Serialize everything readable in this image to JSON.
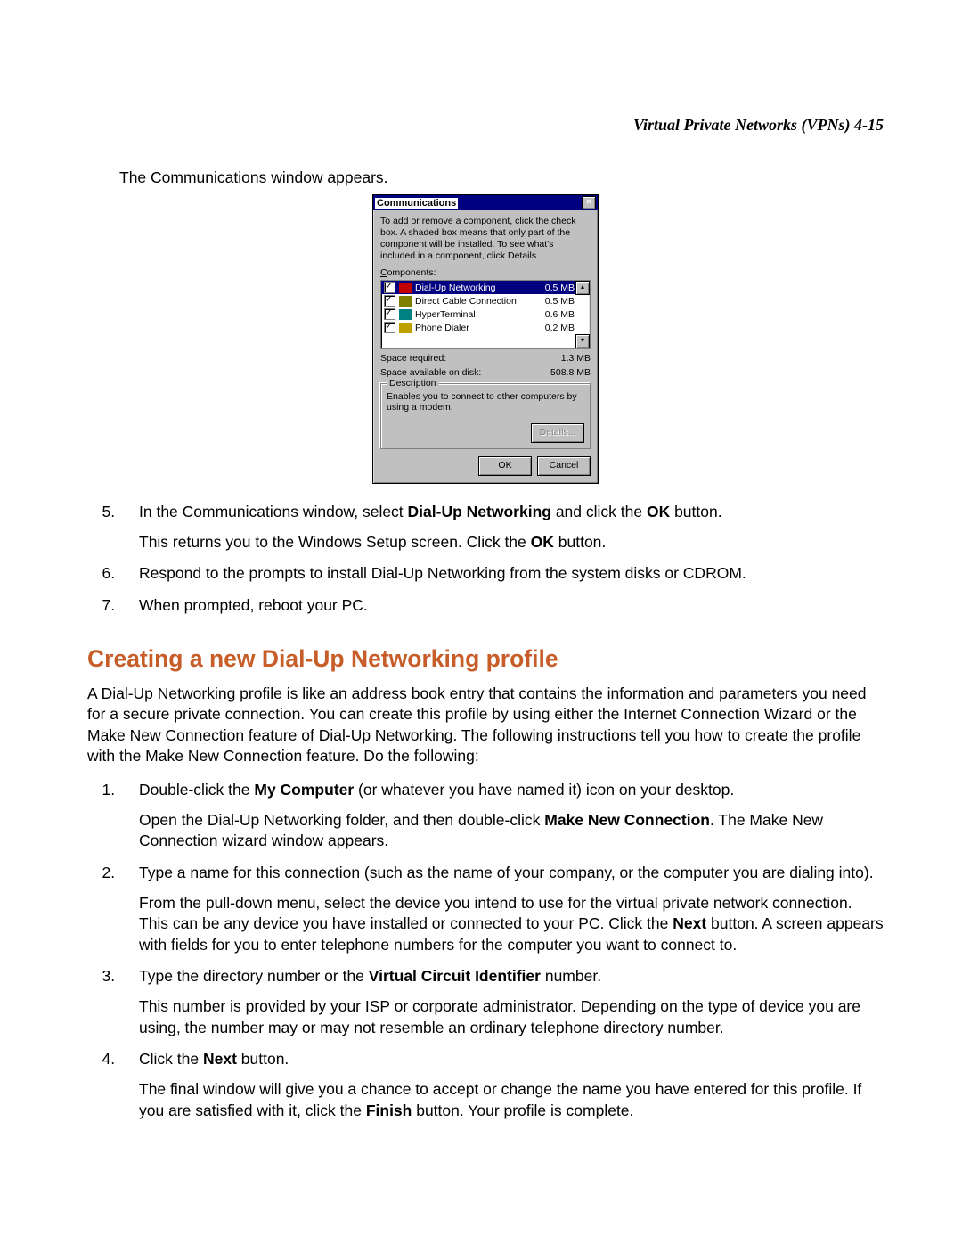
{
  "header": {
    "running_head": "Virtual Private Networks (VPNs)   4-15"
  },
  "lead": "The Communications window appears.",
  "dialog": {
    "title": "Communications",
    "close_glyph": "×",
    "intro": "To add or remove a component, click the check box. A shaded box means that only part of the component will be installed. To see what's included in a component, click Details.",
    "components_label": "Components:",
    "items": [
      {
        "name": "Dial-Up Networking",
        "size": "0.5 MB",
        "checked": true,
        "selected": true,
        "icon_color": "#c00000"
      },
      {
        "name": "Direct Cable Connection",
        "size": "0.5 MB",
        "checked": true,
        "selected": false,
        "icon_color": "#808000"
      },
      {
        "name": "HyperTerminal",
        "size": "0.6 MB",
        "checked": true,
        "selected": false,
        "icon_color": "#008080"
      },
      {
        "name": "Phone Dialer",
        "size": "0.2 MB",
        "checked": true,
        "selected": false,
        "icon_color": "#c0a000"
      }
    ],
    "scroll_up": "▴",
    "scroll_down": "▾",
    "space_required_label": "Space required:",
    "space_required_value": "1.3 MB",
    "space_available_label": "Space available on disk:",
    "space_available_value": "508.8 MB",
    "description_legend": "Description",
    "description_text": "Enables you to connect to other computers by using a modem.",
    "details_label": "Details...",
    "ok_label": "OK",
    "cancel_label": "Cancel"
  },
  "steps_a": {
    "s5_a": "In the Communications window, select ",
    "s5_bold1": "Dial-Up Networking",
    "s5_b": " and click the ",
    "s5_bold2": "OK",
    "s5_c": " button.",
    "s5_p_a": "This returns you to the Windows Setup screen. Click the ",
    "s5_p_bold": "OK",
    "s5_p_b": " button.",
    "s6": "Respond to the prompts to install Dial-Up Networking from the system disks or CDROM.",
    "s7": "When prompted, reboot your PC."
  },
  "section_heading": "Creating a new Dial-Up Networking profile",
  "section_intro": "A Dial-Up Networking profile is like an address book entry that contains the information and parameters you need for a secure private connection. You can create this profile by using either the Internet Connection Wizard or the Make New Connection feature of Dial-Up Networking. The following instructions tell you how to create the profile with the Make New Connection feature. Do the following:",
  "steps_b": {
    "s1_a": "Double-click the ",
    "s1_bold": "My Computer",
    "s1_b": " (or whatever you have named it) icon on your desktop.",
    "s1_p_a": "Open the Dial-Up Networking folder, and then double-click ",
    "s1_p_bold": "Make New Connection",
    "s1_p_b": ". The Make New Connection wizard window appears.",
    "s2": "Type a name for this connection (such as the name of your company, or the computer you are dialing into).",
    "s2_p_a": "From the pull-down menu, select the device you intend to use for the virtual private network connection. This can be any device you have installed or connected to your PC. Click the ",
    "s2_p_bold": "Next",
    "s2_p_b": " button. A screen appears with fields for you to enter telephone numbers for the computer you want to connect to.",
    "s3_a": "Type the directory number or the ",
    "s3_bold": "Virtual Circuit Identifier",
    "s3_b": " number.",
    "s3_p": "This number is provided by your ISP or corporate administrator. Depending on the type of device you are using, the number may or may not resemble an ordinary telephone directory number.",
    "s4_a": "Click the ",
    "s4_bold": "Next",
    "s4_b": " button.",
    "s4_p_a": "The final window will give you a chance to accept or change the name you have entered for this profile. If you are satisfied with it, click the ",
    "s4_p_bold": "Finish",
    "s4_p_b": " button. Your profile is complete."
  }
}
